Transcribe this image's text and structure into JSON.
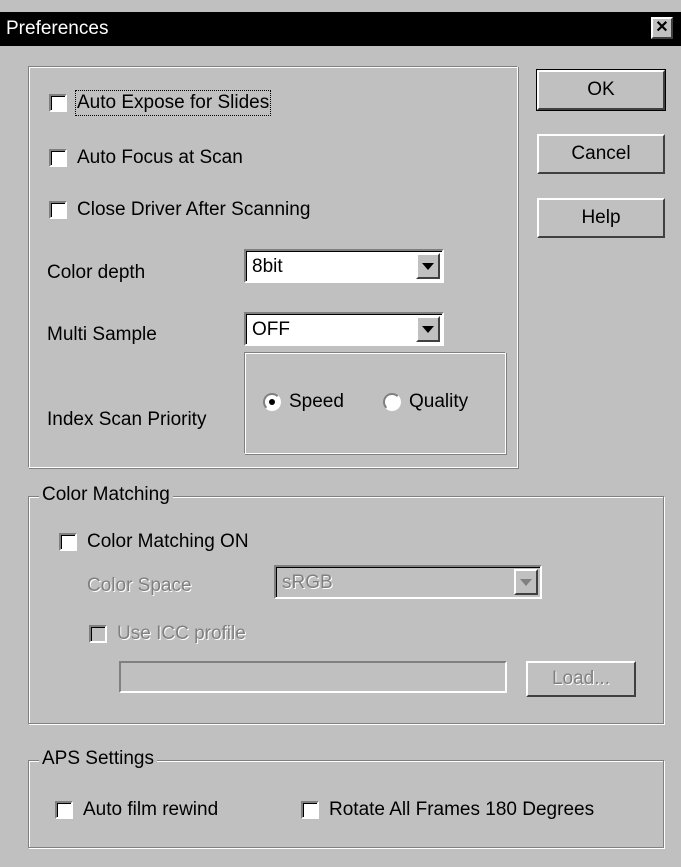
{
  "window": {
    "title": "Preferences",
    "close_icon": "close-icon"
  },
  "buttons": {
    "ok": "OK",
    "cancel": "Cancel",
    "help": "Help"
  },
  "options": {
    "auto_expose": {
      "label": "Auto Expose for Slides",
      "checked": false
    },
    "auto_focus": {
      "label": "Auto Focus at Scan",
      "checked": false
    },
    "close_driver": {
      "label": "Close Driver After Scanning",
      "checked": false
    },
    "color_depth": {
      "label": "Color depth",
      "value": "8bit"
    },
    "multi_sample": {
      "label": "Multi Sample",
      "value": "OFF"
    },
    "index_scan_priority": {
      "label": "Index Scan Priority",
      "speed": "Speed",
      "quality": "Quality",
      "selected": "Speed"
    }
  },
  "color_matching": {
    "title": "Color Matching",
    "on": {
      "label": "Color Matching ON",
      "checked": false
    },
    "color_space": {
      "label": "Color Space",
      "value": "sRGB"
    },
    "use_icc": {
      "label": "Use ICC profile",
      "checked": false
    },
    "profile_path": "",
    "load": "Load..."
  },
  "aps": {
    "title": "APS Settings",
    "auto_rewind": {
      "label": "Auto film rewind",
      "checked": false
    },
    "rotate": {
      "label": "Rotate All Frames 180 Degrees",
      "checked": false
    }
  }
}
